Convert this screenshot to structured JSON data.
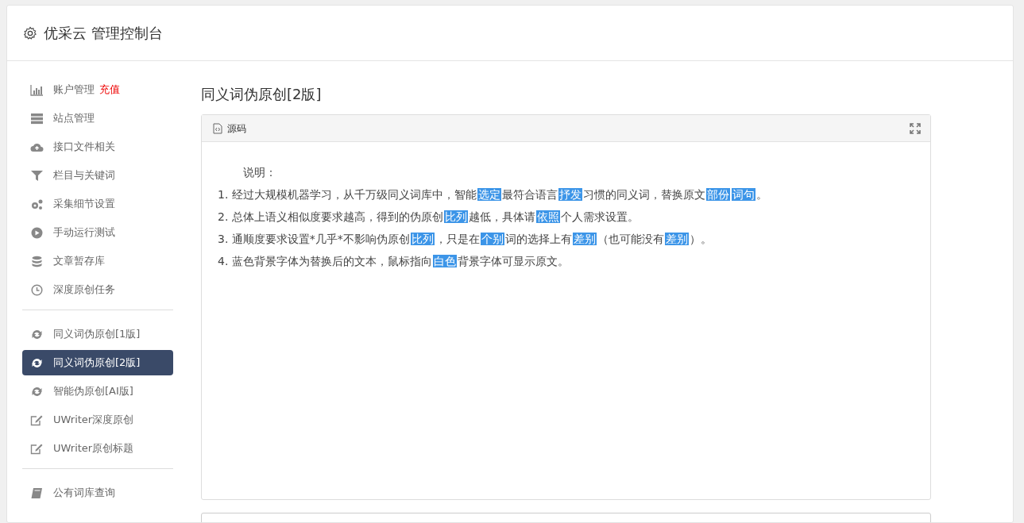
{
  "header": {
    "title": "优采云 管理控制台"
  },
  "sidebar": {
    "groups": [
      {
        "items": [
          {
            "label": "账户管理",
            "badge": "充值",
            "kind": "chart",
            "selected": false
          },
          {
            "label": "站点管理",
            "kind": "server",
            "selected": false
          },
          {
            "label": "接口文件相关",
            "kind": "cloud",
            "selected": false
          },
          {
            "label": "栏目与关键词",
            "kind": "filter",
            "selected": false
          },
          {
            "label": "采集细节设置",
            "kind": "gears",
            "selected": false
          },
          {
            "label": "手动运行测试",
            "kind": "play",
            "selected": false
          },
          {
            "label": "文章暂存库",
            "kind": "database",
            "selected": false
          },
          {
            "label": "深度原创任务",
            "kind": "clock",
            "selected": false
          }
        ]
      },
      {
        "items": [
          {
            "label": "同义词伪原创[1版]",
            "kind": "refresh",
            "selected": false
          },
          {
            "label": "同义词伪原创[2版]",
            "kind": "refresh",
            "selected": true
          },
          {
            "label": "智能伪原创[AI版]",
            "kind": "refresh",
            "selected": false
          },
          {
            "label": "UWriter深度原创",
            "kind": "edit",
            "selected": false
          },
          {
            "label": "UWriter原创标题",
            "kind": "edit",
            "selected": false
          }
        ]
      },
      {
        "items": [
          {
            "label": "公有词库查询",
            "kind": "book",
            "selected": false
          }
        ]
      }
    ]
  },
  "page_title": "同义词伪原创[2版]",
  "editor": {
    "tab": "源码",
    "heading": "说明：",
    "lines": [
      [
        {
          "kind": "plain",
          "text": "1. 经过大规模机器学习，从千万级同义词库中，智能"
        },
        {
          "kind": "swap",
          "text": "选定"
        },
        {
          "kind": "plain",
          "text": "最符合语言"
        },
        {
          "kind": "swap",
          "text": "抒发"
        },
        {
          "kind": "plain",
          "text": "习惯的同义词，替换原文"
        },
        {
          "kind": "swap",
          "text": "部份"
        },
        {
          "kind": "swap",
          "text": "词句"
        },
        {
          "kind": "plain",
          "text": "。"
        }
      ],
      [
        {
          "kind": "plain",
          "text": "2. 总体上语义相似度要求越高，得到的伪原创"
        },
        {
          "kind": "swap",
          "text": "比列"
        },
        {
          "kind": "plain",
          "text": "越低，具体请"
        },
        {
          "kind": "swap",
          "text": "依照"
        },
        {
          "kind": "plain",
          "text": "个人需求设置。"
        }
      ],
      [
        {
          "kind": "plain",
          "text": "3. 通顺度要求设置*几乎*不影响伪原创"
        },
        {
          "kind": "swap",
          "text": "比列"
        },
        {
          "kind": "plain",
          "text": "，只是在"
        },
        {
          "kind": "swap",
          "text": "个别"
        },
        {
          "kind": "plain",
          "text": "词的选择上有"
        },
        {
          "kind": "swap",
          "text": "差别"
        },
        {
          "kind": "plain",
          "text": "（也可能没有"
        },
        {
          "kind": "swap",
          "text": "差别"
        },
        {
          "kind": "plain",
          "text": "）。"
        }
      ],
      [
        {
          "kind": "plain",
          "text": "4. 蓝色背景字体为替换后的文本，鼠标指向"
        },
        {
          "kind": "swap",
          "text": "白色"
        },
        {
          "kind": "plain",
          "text": "背景字体可显示原文。"
        }
      ]
    ]
  }
}
